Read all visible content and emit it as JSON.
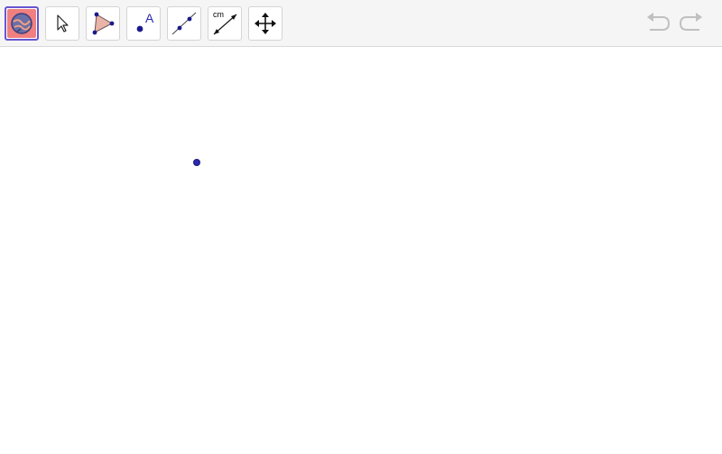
{
  "toolbar": {
    "tools": [
      {
        "name": "graphing-tool",
        "selected": true,
        "icon": "globe-graph-icon"
      },
      {
        "name": "move-tool",
        "selected": false,
        "icon": "arrow-cursor-icon"
      },
      {
        "name": "polygon-tool",
        "selected": false,
        "icon": "triangle-icon"
      },
      {
        "name": "point-tool",
        "selected": false,
        "icon": "point-label-icon",
        "label": "A"
      },
      {
        "name": "line-tool",
        "selected": false,
        "icon": "line-through-points-icon"
      },
      {
        "name": "measure-tool",
        "selected": false,
        "icon": "distance-measure-icon",
        "label": "cm"
      },
      {
        "name": "move-graphics-view-tool",
        "selected": false,
        "icon": "move-arrows-icon"
      }
    ],
    "undo_icon": "undo-icon",
    "redo_icon": "redo-icon"
  },
  "colors": {
    "selected_border": "#6557d2",
    "selected_fill": "#f08080",
    "point_color": "#2a2ab0",
    "triangle_fill": "#e8b4a8",
    "toolbar_bg": "#f5f5f5",
    "disabled_icon": "#c0c0c0"
  },
  "canvas": {
    "points": [
      {
        "name": "point",
        "label": ""
      }
    ]
  }
}
